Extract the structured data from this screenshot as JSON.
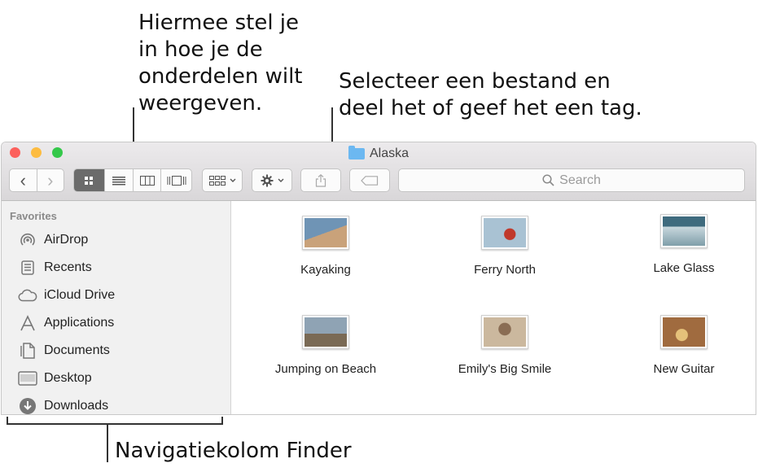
{
  "callouts": {
    "view_options": [
      "Hiermee stel je",
      "in hoe je de",
      "onderdelen wilt",
      "weergeven."
    ],
    "share_tag": [
      "Selecteer een bestand en",
      "deel het of geef het een tag."
    ],
    "sidebar": "Navigatiekolom Finder"
  },
  "window": {
    "title": "Alaska",
    "search_placeholder": "Search"
  },
  "toolbar": {
    "back": "‹",
    "forward": "›"
  },
  "sidebar": {
    "heading": "Favorites",
    "items": [
      {
        "label": "AirDrop",
        "icon": "airdrop-icon"
      },
      {
        "label": "Recents",
        "icon": "recents-icon"
      },
      {
        "label": "iCloud Drive",
        "icon": "cloud-icon"
      },
      {
        "label": "Applications",
        "icon": "applications-icon"
      },
      {
        "label": "Documents",
        "icon": "documents-icon"
      },
      {
        "label": "Desktop",
        "icon": "desktop-icon"
      },
      {
        "label": "Downloads",
        "icon": "downloads-icon"
      }
    ]
  },
  "files": [
    {
      "name": "Kayaking",
      "colors": [
        "#6f94b5",
        "#c9a27a"
      ]
    },
    {
      "name": "Ferry North",
      "colors": [
        "#a9c2d3",
        "#c0392b"
      ]
    },
    {
      "name": "Lake Glass",
      "colors": [
        "#3f6b7e",
        "#c9d8de"
      ]
    },
    {
      "name": "Jumping on Beach",
      "colors": [
        "#8fa3b4",
        "#7a6a55"
      ]
    },
    {
      "name": "Emily's Big Smile",
      "colors": [
        "#cbb89e",
        "#8a6d54"
      ]
    },
    {
      "name": "New Guitar",
      "colors": [
        "#a06b3f",
        "#e5c17a"
      ]
    }
  ],
  "colors": {
    "close": "#fc605c",
    "minimize": "#fdbc40",
    "zoom": "#34c84a",
    "folder": "#6cb8f1"
  }
}
